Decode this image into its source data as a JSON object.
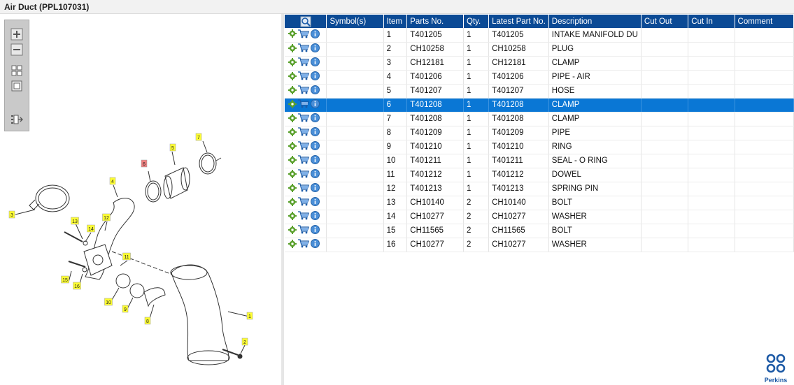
{
  "window": {
    "title": "Air Duct (PPL107031)"
  },
  "toolbox": {
    "tools": [
      {
        "name": "zoom-in-icon"
      },
      {
        "name": "zoom-out-icon"
      },
      {
        "name": "fit-all-icon"
      },
      {
        "name": "actual-size-icon"
      },
      {
        "name": "export-list-icon"
      }
    ]
  },
  "diagram": {
    "callouts": [
      "1",
      "2",
      "3",
      "4",
      "5",
      "6",
      "7",
      "8",
      "9",
      "10",
      "11",
      "12",
      "13",
      "14",
      "15",
      "16"
    ],
    "highlighted_callout": "6"
  },
  "table": {
    "columns": [
      "",
      "Symbol(s)",
      "Item",
      "Parts No.",
      "Qty.",
      "Latest Part No.",
      "Description",
      "Cut Out",
      "Cut In",
      "Comment"
    ],
    "selected_row": 5,
    "rows": [
      {
        "symbol": "",
        "item": "1",
        "part_no": "T401205",
        "qty": "1",
        "latest": "T401205",
        "description": "INTAKE MANIFOLD DU",
        "cut_out": "",
        "cut_in": "",
        "comment": ""
      },
      {
        "symbol": "",
        "item": "2",
        "part_no": "CH10258",
        "qty": "1",
        "latest": "CH10258",
        "description": "PLUG",
        "cut_out": "",
        "cut_in": "",
        "comment": ""
      },
      {
        "symbol": "",
        "item": "3",
        "part_no": "CH12181",
        "qty": "1",
        "latest": "CH12181",
        "description": "CLAMP",
        "cut_out": "",
        "cut_in": "",
        "comment": ""
      },
      {
        "symbol": "",
        "item": "4",
        "part_no": "T401206",
        "qty": "1",
        "latest": "T401206",
        "description": "PIPE - AIR",
        "cut_out": "",
        "cut_in": "",
        "comment": ""
      },
      {
        "symbol": "",
        "item": "5",
        "part_no": "T401207",
        "qty": "1",
        "latest": "T401207",
        "description": "HOSE",
        "cut_out": "",
        "cut_in": "",
        "comment": ""
      },
      {
        "symbol": "",
        "item": "6",
        "part_no": "T401208",
        "qty": "1",
        "latest": "T401208",
        "description": "CLAMP",
        "cut_out": "",
        "cut_in": "",
        "comment": ""
      },
      {
        "symbol": "",
        "item": "7",
        "part_no": "T401208",
        "qty": "1",
        "latest": "T401208",
        "description": "CLAMP",
        "cut_out": "",
        "cut_in": "",
        "comment": ""
      },
      {
        "symbol": "",
        "item": "8",
        "part_no": "T401209",
        "qty": "1",
        "latest": "T401209",
        "description": "PIPE",
        "cut_out": "",
        "cut_in": "",
        "comment": ""
      },
      {
        "symbol": "",
        "item": "9",
        "part_no": "T401210",
        "qty": "1",
        "latest": "T401210",
        "description": "RING",
        "cut_out": "",
        "cut_in": "",
        "comment": ""
      },
      {
        "symbol": "",
        "item": "10",
        "part_no": "T401211",
        "qty": "1",
        "latest": "T401211",
        "description": "SEAL - O RING",
        "cut_out": "",
        "cut_in": "",
        "comment": ""
      },
      {
        "symbol": "",
        "item": "11",
        "part_no": "T401212",
        "qty": "1",
        "latest": "T401212",
        "description": "DOWEL",
        "cut_out": "",
        "cut_in": "",
        "comment": ""
      },
      {
        "symbol": "",
        "item": "12",
        "part_no": "T401213",
        "qty": "1",
        "latest": "T401213",
        "description": "SPRING PIN",
        "cut_out": "",
        "cut_in": "",
        "comment": ""
      },
      {
        "symbol": "",
        "item": "13",
        "part_no": "CH10140",
        "qty": "2",
        "latest": "CH10140",
        "description": "BOLT",
        "cut_out": "",
        "cut_in": "",
        "comment": ""
      },
      {
        "symbol": "",
        "item": "14",
        "part_no": "CH10277",
        "qty": "2",
        "latest": "CH10277",
        "description": "WASHER",
        "cut_out": "",
        "cut_in": "",
        "comment": ""
      },
      {
        "symbol": "",
        "item": "15",
        "part_no": "CH11565",
        "qty": "2",
        "latest": "CH11565",
        "description": "BOLT",
        "cut_out": "",
        "cut_in": "",
        "comment": ""
      },
      {
        "symbol": "",
        "item": "16",
        "part_no": "CH10277",
        "qty": "2",
        "latest": "CH10277",
        "description": "WASHER",
        "cut_out": "",
        "cut_in": "",
        "comment": ""
      }
    ],
    "row_icons": [
      "gear-icon",
      "cart-icon",
      "info-icon"
    ]
  },
  "brand": {
    "name": "Perkins"
  },
  "colors": {
    "header": "#0b4a95",
    "selected": "#0a77d5",
    "callout": "#ffff33",
    "callout_highlight": "#f08080"
  }
}
